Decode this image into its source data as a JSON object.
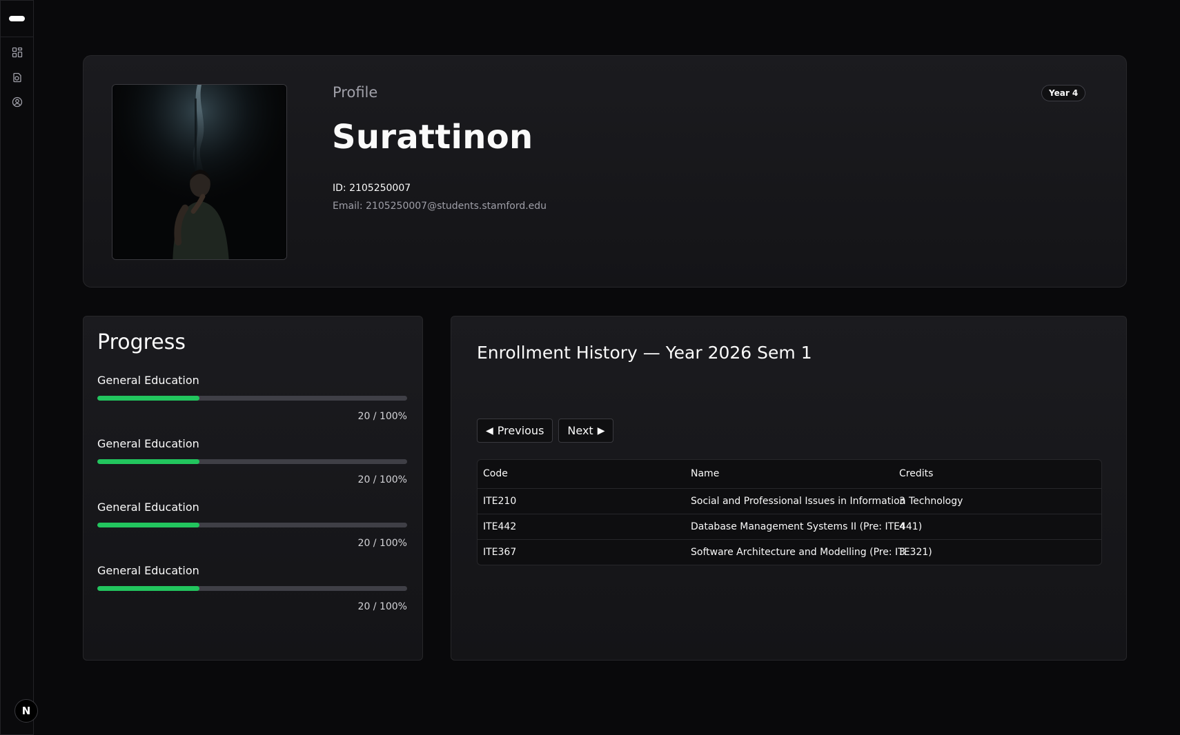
{
  "profile": {
    "section_label": "Profile",
    "name": "Surattinon",
    "id_text": "ID: 2105250007",
    "email_text": "Email: 2105250007@students.stamford.edu",
    "year_badge": "Year 4"
  },
  "progress": {
    "title": "Progress",
    "items": [
      {
        "label": "General Education",
        "value_text": "20 / 100%",
        "fill_fraction": 0.33
      },
      {
        "label": "General Education",
        "value_text": "20 / 100%",
        "fill_fraction": 0.33
      },
      {
        "label": "General Education",
        "value_text": "20 / 100%",
        "fill_fraction": 0.33
      },
      {
        "label": "General Education",
        "value_text": "20 / 100%",
        "fill_fraction": 0.33
      }
    ],
    "fill_color": "#22c55e"
  },
  "enrollment": {
    "title": "Enrollment History — Year 2026 Sem 1",
    "previous_label": "Previous",
    "next_label": "Next",
    "columns": [
      "Code",
      "Name",
      "Credits"
    ],
    "rows": [
      {
        "code": "ITE210",
        "name": "Social and Professional Issues in Information Technology",
        "credits": "3"
      },
      {
        "code": "ITE442",
        "name": "Database Management Systems II (Pre: ITE441)",
        "credits": "4"
      },
      {
        "code": "ITE367",
        "name": "Software Architecture and Modelling (Pre: ITE321)",
        "credits": "3"
      }
    ]
  },
  "sidebar": {
    "icons": [
      "dashboard-icon",
      "courses-icon",
      "user-icon"
    ],
    "footer_badge": "N"
  }
}
